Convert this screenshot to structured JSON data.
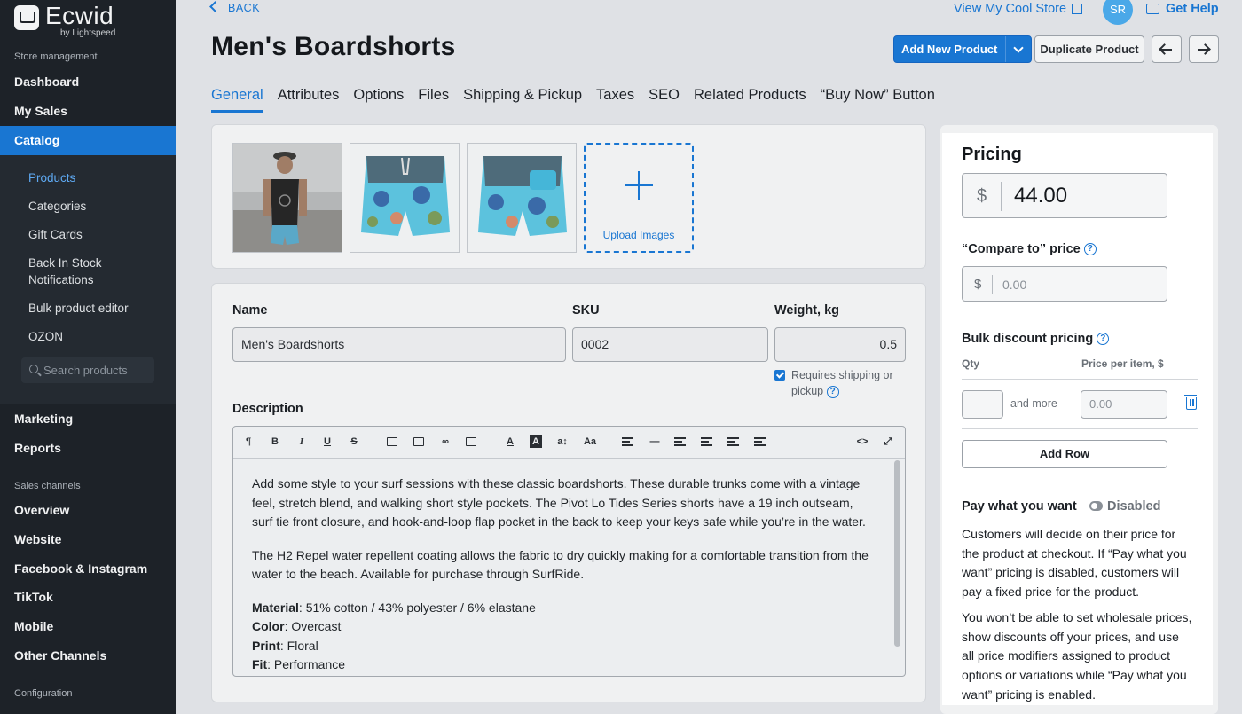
{
  "sidebar": {
    "logo_name": "Ecwid",
    "logo_sub": "by Lightspeed",
    "section_store": "Store management",
    "items_top": [
      "Dashboard",
      "My Sales",
      "Catalog"
    ],
    "catalog_sub": [
      "Products",
      "Categories",
      "Gift Cards",
      "Back In Stock Notifications",
      "Bulk product editor",
      "OZON"
    ],
    "search_placeholder": "Search products",
    "items_mid": [
      "Marketing",
      "Reports"
    ],
    "section_sales": "Sales channels",
    "items_sales": [
      "Overview",
      "Website",
      "Facebook & Instagram",
      "TikTok",
      "Mobile",
      "Other Channels"
    ],
    "section_config": "Configuration"
  },
  "header": {
    "back": "BACK",
    "view_store": "View My Cool Store",
    "avatar": "SR",
    "get_help": "Get Help",
    "title": "Men's Boardshorts",
    "add_new": "Add New Product",
    "duplicate": "Duplicate Product"
  },
  "tabs": [
    "General",
    "Attributes",
    "Options",
    "Files",
    "Shipping & Pickup",
    "Taxes",
    "SEO",
    "Related Products",
    "“Buy Now” Button"
  ],
  "images": {
    "upload_label": "Upload Images"
  },
  "form": {
    "name_label": "Name",
    "name_value": "Men's Boardshorts",
    "sku_label": "SKU",
    "sku_value": "0002",
    "weight_label": "Weight, kg",
    "weight_value": "0.5",
    "requires_shipping": "Requires shipping or pickup",
    "description_label": "Description"
  },
  "description": {
    "p1": "Add some style to your surf sessions with these classic boardshorts. These durable trunks come with a vintage feel, stretch blend, and walking short style pockets. The Pivot Lo Tides Series shorts have a 19 inch outseam, surf tie front closure, and hook-and-loop flap pocket in the back to keep your keys safe while you’re in the water.",
    "p2": "The H2 Repel water repellent coating allows the fabric to dry quickly making for a comfortable transition from the water to the beach. Available for purchase through SurfRide.",
    "specs": [
      {
        "k": "Material",
        "v": ": 51% cotton / 43% polyester / 6% elastane"
      },
      {
        "k": "Color",
        "v": ": Overcast"
      },
      {
        "k": "Print",
        "v": ": Floral"
      },
      {
        "k": "Fit",
        "v": ": Performance"
      }
    ]
  },
  "pricing": {
    "title": "Pricing",
    "currency": "$",
    "price": "44.00",
    "compare_label": "“Compare to” price",
    "compare_placeholder": "0.00",
    "bulk_label": "Bulk discount pricing",
    "qty_header": "Qty",
    "price_per_item_header": "Price per item, $",
    "and_more": "and more",
    "bulk_price_placeholder": "0.00",
    "add_row": "Add Row",
    "pwyw_label": "Pay what you want",
    "pwyw_state": "Disabled",
    "pwyw_text1": "Customers will decide on their price for the product at checkout. If “Pay what you want” pricing is disabled, customers will pay a fixed price for the product.",
    "pwyw_text2": "You won’t be able to set wholesale prices, show discounts off your prices, and use all price modifiers assigned to product options or variations while “Pay what you want” pricing is enabled."
  },
  "colors": {
    "accent": "#1976d2",
    "sidebar_bg": "#1d2228"
  }
}
